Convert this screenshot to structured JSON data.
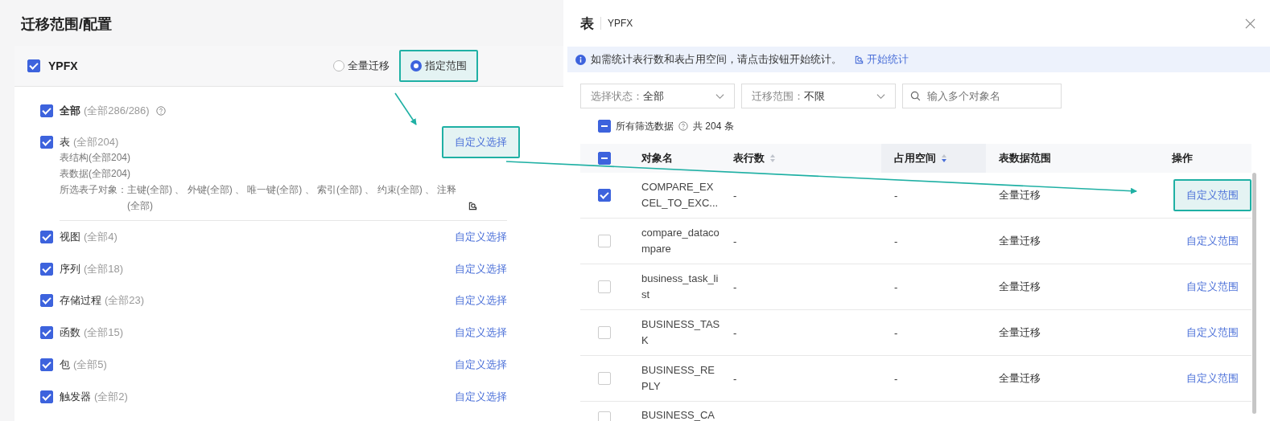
{
  "config_panel": {
    "title": "迁移范围/配置",
    "schema": {
      "name": "YPFX",
      "checked": true
    },
    "scope_options": [
      {
        "label": "全量迁移",
        "selected": false,
        "highlighted": false
      },
      {
        "label": "指定范围",
        "selected": true,
        "highlighted": true
      }
    ],
    "all": {
      "label": "全部",
      "count": "(全部286/286)",
      "checked": true
    },
    "table_group": {
      "label": "表",
      "count": "(全部204)",
      "checked": true,
      "action": "自定义选择",
      "highlighted": true,
      "details": [
        "表结构(全部204)",
        "表数据(全部204)"
      ],
      "sub_objects_label": "所选表子对象：",
      "sub_objects": "主键(全部) 、 外键(全部) 、 唯一键(全部) 、 索引(全部) 、 约束(全部) 、 注释(全部)"
    },
    "object_types": [
      {
        "label": "视图",
        "count": "(全部4)",
        "checked": true,
        "action": "自定义选择"
      },
      {
        "label": "序列",
        "count": "(全部18)",
        "checked": true,
        "action": "自定义选择"
      },
      {
        "label": "存储过程",
        "count": "(全部23)",
        "checked": true,
        "action": "自定义选择"
      },
      {
        "label": "函数",
        "count": "(全部15)",
        "checked": true,
        "action": "自定义选择"
      },
      {
        "label": "包",
        "count": "(全部5)",
        "checked": true,
        "action": "自定义选择"
      },
      {
        "label": "触发器",
        "count": "(全部2)",
        "checked": true,
        "action": "自定义选择"
      }
    ]
  },
  "table_dialog": {
    "title": "表",
    "schema": "YPFX",
    "info": {
      "text": "如需统计表行数和表占用空间，请点击按钮开始统计。",
      "link": "开始统计"
    },
    "filters": [
      {
        "kind": "select",
        "label": "选择状态：",
        "value": "全部"
      },
      {
        "kind": "select",
        "label": "迁移范围：",
        "value": "不限"
      },
      {
        "kind": "search",
        "placeholder": "输入多个对象名"
      }
    ],
    "select_all": {
      "label": "所有筛选数据",
      "count": "共 204 条",
      "indeterminate": true
    },
    "columns": [
      {
        "label": "对象名"
      },
      {
        "label": "表行数",
        "descending": false
      },
      {
        "label": "占用空间",
        "descending": true
      },
      {
        "label": "表数据范围"
      },
      {
        "label": "操作"
      }
    ],
    "header_indeterminate": true,
    "rows": [
      {
        "checked": true,
        "name": "COMPARE_EXCEL_TO_EXC...",
        "rows": "-",
        "space": "-",
        "range": "全量迁移",
        "action": "自定义范围",
        "highlighted": true
      },
      {
        "checked": false,
        "name": "compare_datacompare",
        "rows": "-",
        "space": "-",
        "range": "全量迁移",
        "action": "自定义范围",
        "highlighted": false
      },
      {
        "checked": false,
        "name": "business_task_list",
        "rows": "-",
        "space": "-",
        "range": "全量迁移",
        "action": "自定义范围",
        "highlighted": false
      },
      {
        "checked": false,
        "name": "BUSINESS_TASK",
        "rows": "-",
        "space": "-",
        "range": "全量迁移",
        "action": "自定义范围",
        "highlighted": false
      },
      {
        "checked": false,
        "name": "BUSINESS_REPLY",
        "rows": "-",
        "space": "-",
        "range": "全量迁移",
        "action": "自定义范围",
        "highlighted": false
      },
      {
        "checked": false,
        "name": "BUSINESS_CA"
      }
    ]
  }
}
